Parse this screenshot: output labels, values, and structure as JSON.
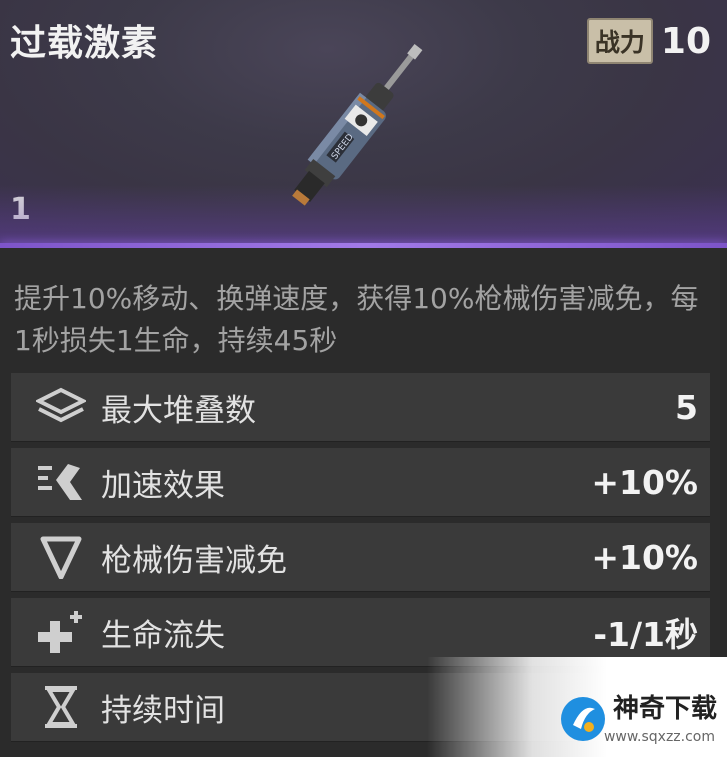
{
  "item": {
    "title": "过载激素",
    "power_label": "战力",
    "power_value": "10",
    "count": "1",
    "description": "提升10%移动、换弹速度，获得10%枪械伤害减免，每1秒损失1生命，持续45秒"
  },
  "stats": [
    {
      "label": "最大堆叠数",
      "value": "5",
      "icon": "layers-icon"
    },
    {
      "label": "加速效果",
      "value": "+10%",
      "icon": "speed-icon"
    },
    {
      "label": "枪械伤害减免",
      "value": "+10%",
      "icon": "shield-triangle-icon"
    },
    {
      "label": "生命流失",
      "value": "-1/1秒",
      "icon": "health-plus-icon"
    },
    {
      "label": "持续时间",
      "value": "",
      "icon": "hourglass-icon"
    }
  ],
  "watermark": {
    "name": "神奇下载",
    "url": "www.sqxzz.com"
  },
  "colors": {
    "accent": "#8f62e0",
    "header_bg": "#3d3a49",
    "row_bg": "#3a3a3a",
    "power_badge": "#c9bfa8"
  }
}
